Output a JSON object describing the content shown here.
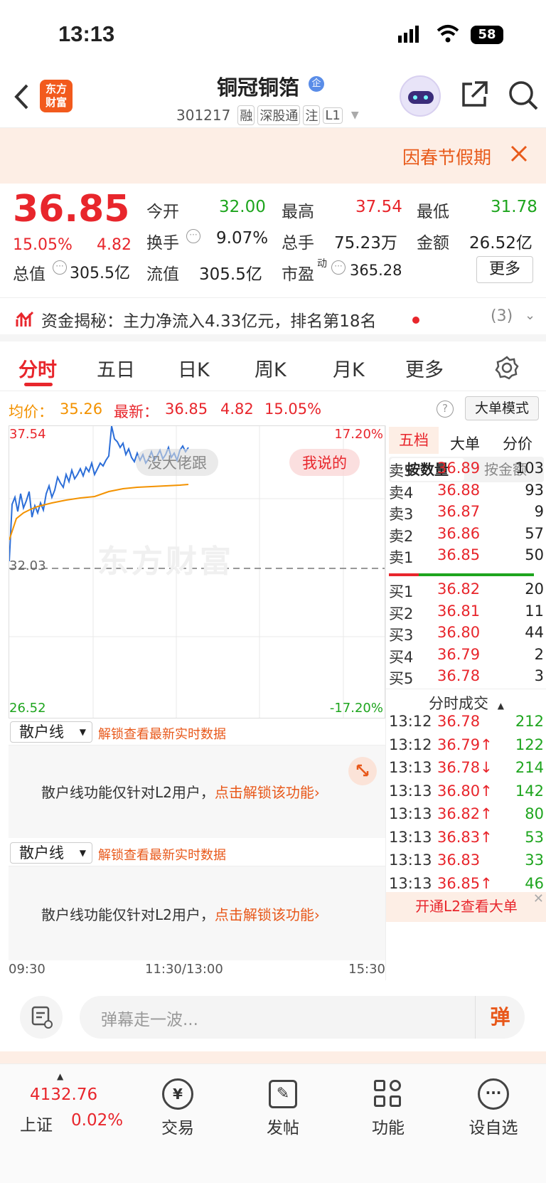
{
  "status": {
    "time": "13:13",
    "battery": "58"
  },
  "header": {
    "title": "铜冠铜箔",
    "code": "301217",
    "tags": [
      "融",
      "深股通",
      "注",
      "L1"
    ],
    "qi_badge": "企"
  },
  "banner": {
    "text": "因春节假期"
  },
  "quote": {
    "price": "36.85",
    "pct": "15.05%",
    "chg": "4.82",
    "open_label": "今开",
    "open": "32.00",
    "high_label": "最高",
    "high": "37.54",
    "low_label": "最低",
    "low": "31.78",
    "turn_label": "换手",
    "turn": "9.07%",
    "vol_label": "总手",
    "vol": "75.23万",
    "amt_label": "金额",
    "amt": "26.52亿",
    "mcap_label": "总值",
    "mcap": "305.5亿",
    "float_label": "流值",
    "float": "305.5亿",
    "pe_label": "市盈",
    "pe_sup": "动",
    "pe": "365.28",
    "more": "更多"
  },
  "fund": {
    "text": "资金揭秘：主力净流入4.33亿元，排名第18名",
    "count": "(3)"
  },
  "tabs": [
    "分时",
    "五日",
    "日K",
    "周K",
    "月K",
    "更多"
  ],
  "info": {
    "avg_label": "均价：",
    "avg": "35.26",
    "latest_label": "最新：",
    "latest": "36.85",
    "chg": "4.82",
    "pct": "15.05%",
    "mode": "大单模式"
  },
  "chart": {
    "ymax": "37.54",
    "ymin": "26.52",
    "ymid": "32.03",
    "pmax": "17.20%",
    "pmin": "-17.20%",
    "watermark": "东方财富",
    "bubble1": "没大佬跟",
    "bubble2": "我说的",
    "xticks": [
      "09:30",
      "11:30/13:00",
      "15:30"
    ]
  },
  "sub": {
    "name": "散户线",
    "hint": "解锁查看最新实时数据",
    "body": "散户线功能仅针对L2用户，",
    "link": "点击解锁该功能"
  },
  "right": {
    "tabs": [
      "五档",
      "大单",
      "分价"
    ],
    "subtabs": [
      "按数量",
      "按金额"
    ],
    "asks": [
      {
        "l": "卖5",
        "p": "36.89",
        "v": "103"
      },
      {
        "l": "卖4",
        "p": "36.88",
        "v": "93"
      },
      {
        "l": "卖3",
        "p": "36.87",
        "v": "9"
      },
      {
        "l": "卖2",
        "p": "36.86",
        "v": "57"
      },
      {
        "l": "卖1",
        "p": "36.85",
        "v": "50"
      }
    ],
    "bids": [
      {
        "l": "买1",
        "p": "36.82",
        "v": "20"
      },
      {
        "l": "买2",
        "p": "36.81",
        "v": "11"
      },
      {
        "l": "买3",
        "p": "36.80",
        "v": "44"
      },
      {
        "l": "买4",
        "p": "36.79",
        "v": "2"
      },
      {
        "l": "买5",
        "p": "36.78",
        "v": "3"
      }
    ],
    "trades_title": "分时成交",
    "trades": [
      {
        "t": "13:12",
        "p": "36.78",
        "v": "212"
      },
      {
        "t": "13:12",
        "p": "36.79↑",
        "v": "122"
      },
      {
        "t": "13:13",
        "p": "36.78↓",
        "v": "214"
      },
      {
        "t": "13:13",
        "p": "36.80↑",
        "v": "142"
      },
      {
        "t": "13:13",
        "p": "36.82↑",
        "v": "80"
      },
      {
        "t": "13:13",
        "p": "36.83↑",
        "v": "53"
      },
      {
        "t": "13:13",
        "p": "36.83",
        "v": "33"
      },
      {
        "t": "13:13",
        "p": "36.85↑",
        "v": "46"
      }
    ],
    "l2": "开通L2查看大单"
  },
  "dock": {
    "placeholder": "弹幕走一波...",
    "btn": "弹"
  },
  "bottom": {
    "index_val": "4132.76",
    "index_name": "上证",
    "index_pct": "0.02%",
    "items": [
      "交易",
      "发帖",
      "功能",
      "设自选"
    ]
  }
}
